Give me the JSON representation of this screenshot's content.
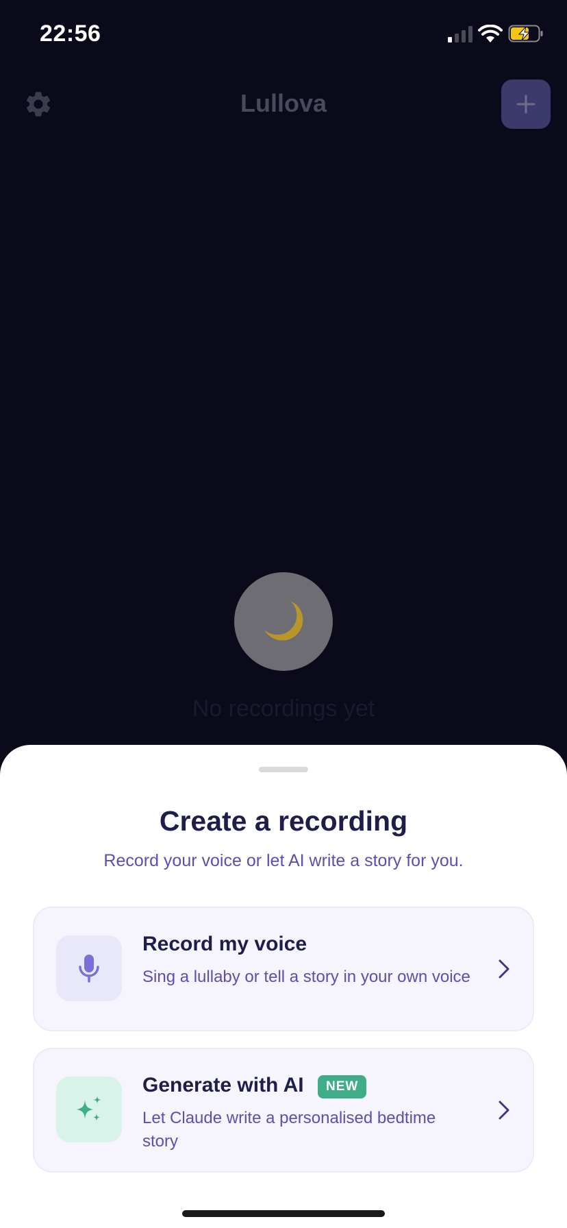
{
  "status_bar": {
    "time": "22:56",
    "signal_icon": "cellular-signal-icon",
    "wifi_icon": "wifi-icon",
    "battery_icon": "battery-charging-icon"
  },
  "header": {
    "title": "Lullova",
    "settings_icon": "gear-icon",
    "add_icon": "plus-icon"
  },
  "empty_state": {
    "icon": "crescent-moon-icon",
    "text": "No recordings yet"
  },
  "sheet": {
    "title": "Create a recording",
    "subtitle": "Record your voice or let AI write a story for you.",
    "options": [
      {
        "title": "Record my voice",
        "description": "Sing a lullaby or tell a story in your own voice",
        "icon": "microphone-icon"
      },
      {
        "title": "Generate with AI",
        "badge": "NEW",
        "description": "Let Claude write a personalised bedtime story",
        "icon": "sparkles-icon"
      }
    ]
  },
  "colors": {
    "background": "#0a0a1a",
    "sheet": "#ffffff",
    "primary_text": "#1f1d4a",
    "accent_text": "#5b4fb0",
    "badge": "#3fae88",
    "add_button": "#3c3a6c"
  }
}
